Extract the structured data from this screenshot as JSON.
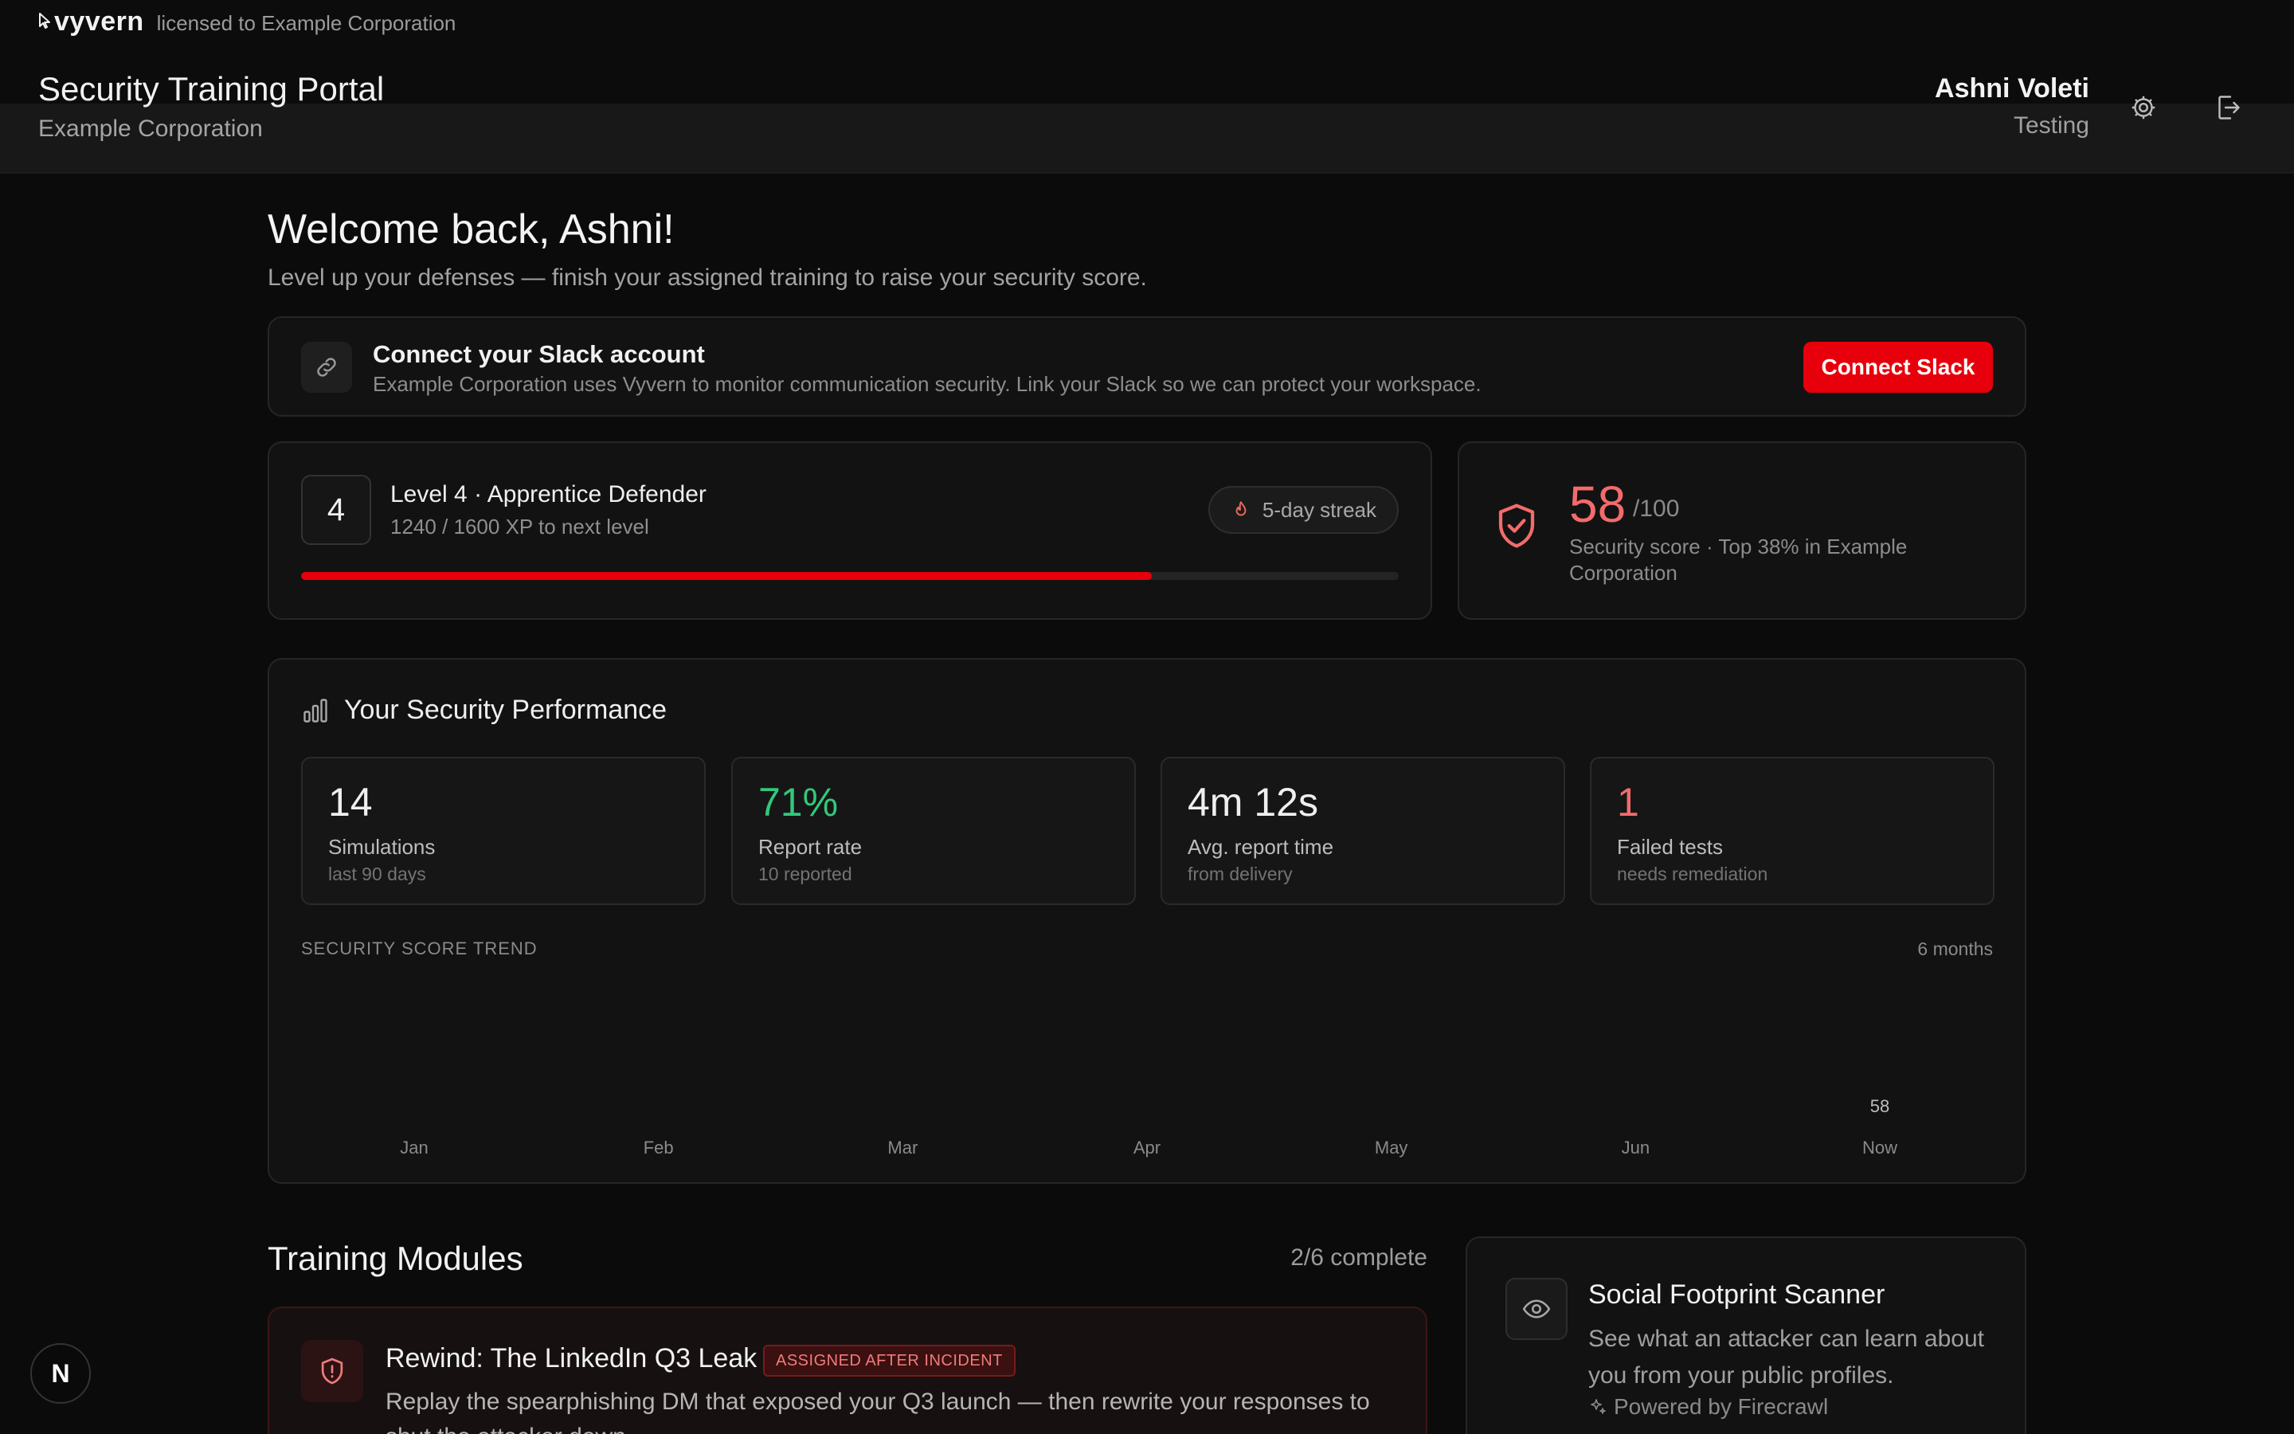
{
  "brand": {
    "name": "vyvern",
    "license": "licensed to Example Corporation"
  },
  "header": {
    "title": "Security Training Portal",
    "org": "Example Corporation",
    "user_name": "Ashni Voleti",
    "user_role": "Testing"
  },
  "welcome": {
    "title": "Welcome back, Ashni!",
    "subtitle": "Level up your defenses — finish your assigned training to raise your security score."
  },
  "slack": {
    "title": "Connect your Slack account",
    "description": "Example Corporation uses Vyvern to monitor communication security. Link your Slack so we can protect your workspace.",
    "button": "Connect Slack"
  },
  "level": {
    "number": "4",
    "title": "Level 4 · Apprentice Defender",
    "xp_text": "1240 / 1600 XP to next level",
    "progress": 0.775,
    "streak": "5-day streak"
  },
  "score": {
    "value": "58",
    "max": "/100",
    "description": "Security score · Top 38% in Example Corporation"
  },
  "performance": {
    "title": "Your Security Performance",
    "stats": [
      {
        "value": "14",
        "label": "Simulations",
        "sub": "last 90 days",
        "color": "#efefef"
      },
      {
        "value": "71%",
        "label": "Report rate",
        "sub": "10 reported",
        "color": "#34c77b"
      },
      {
        "value": "4m 12s",
        "label": "Avg. report time",
        "sub": "from delivery",
        "color": "#efefef"
      },
      {
        "value": "1",
        "label": "Failed tests",
        "sub": "needs remediation",
        "color": "#f36b6b"
      }
    ],
    "trend_label": "SECURITY SCORE TREND",
    "trend_range": "6 months",
    "months": [
      "Jan",
      "Feb",
      "Mar",
      "Apr",
      "May",
      "Jun",
      "Now"
    ],
    "now_value": "58"
  },
  "modules": {
    "title": "Training Modules",
    "count": "2/6 complete",
    "items": [
      {
        "title": "Rewind: The LinkedIn Q3 Leak",
        "badge": "ASSIGNED AFTER INCIDENT",
        "description": "Replay the spearphishing DM that exposed your Q3 launch — then rewrite your responses to shut the attacker down."
      }
    ]
  },
  "scanner": {
    "title": "Social Footprint Scanner",
    "description": "See what an attacker can learn about you from your public profiles.",
    "powered": "Powered by Firecrawl"
  },
  "dev_badge": "N",
  "colors": {
    "accent": "#e7000b",
    "success": "#34c77b",
    "danger": "#f36b6b",
    "background": "#0b0b0b"
  }
}
